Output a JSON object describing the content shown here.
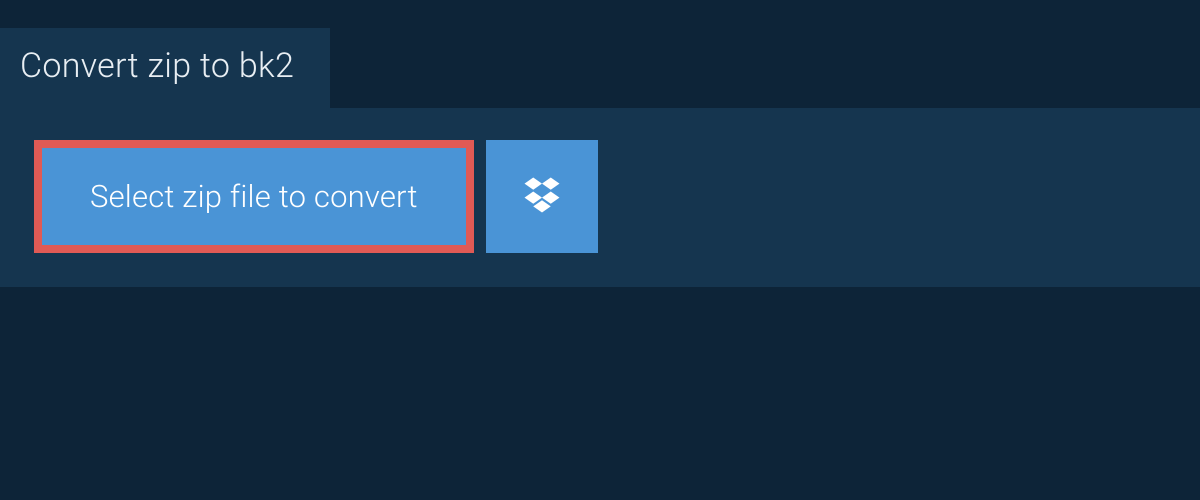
{
  "tab": {
    "title": "Convert zip to bk2"
  },
  "actions": {
    "select_file_label": "Select zip file to convert",
    "dropbox_icon": "dropbox-icon"
  },
  "colors": {
    "background": "#0d2438",
    "panel": "#15354f",
    "button": "#4a94d6",
    "highlight_border": "#e05a55",
    "text_light": "#ffffff"
  }
}
